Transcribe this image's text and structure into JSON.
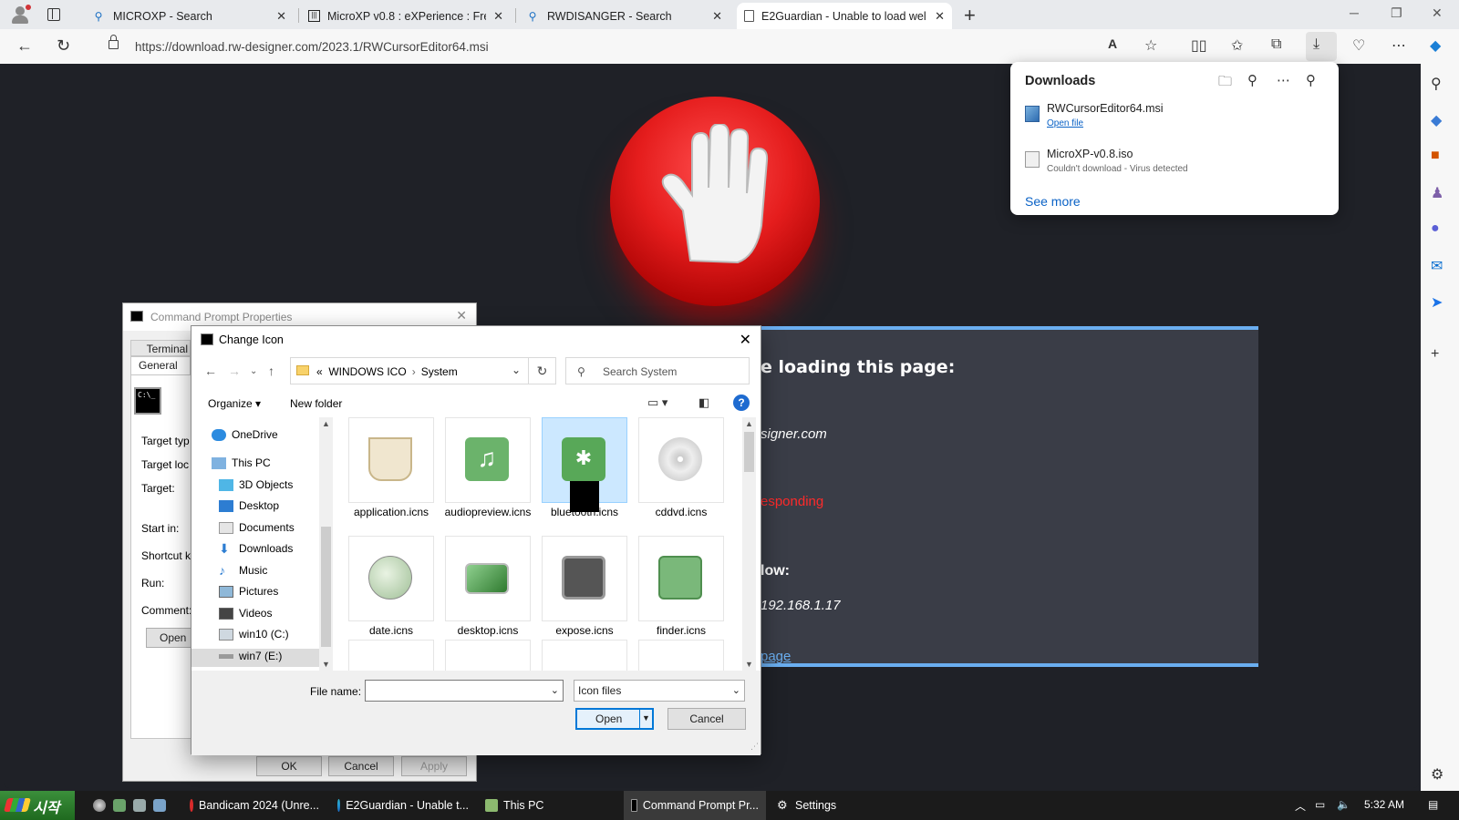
{
  "browser": {
    "tabs": [
      {
        "title": "MICROXP - Search",
        "icon": "search-icon"
      },
      {
        "title": "MicroXP v0.8 : eXPerience : Free",
        "icon": "archive-icon"
      },
      {
        "title": "RWDISANGER - Search",
        "icon": "search-icon"
      },
      {
        "title": "E2Guardian - Unable to load wel",
        "icon": "page-icon"
      }
    ],
    "url": "https://download.rw-designer.com/2023.1/RWCursorEditor64.msi"
  },
  "downloads": {
    "title": "Downloads",
    "items": [
      {
        "name": "RWCursorEditor64.msi",
        "status": "Open file"
      },
      {
        "name": "MicroXP-v0.8.iso",
        "status": "Couldn't download - Virus detected"
      }
    ],
    "see_more": "See more"
  },
  "blocked_page": {
    "line_heading": "e loading this page:",
    "line_domain": "signer.com",
    "line_error": "esponding",
    "line_below": "low:",
    "line_ip": "192.168.1.17",
    "line_link": "page"
  },
  "cmd_props": {
    "title": "Command Prompt Properties",
    "tab_terminal": "Terminal",
    "tab_general": "General",
    "labels": [
      "Target typ",
      "Target loc",
      "Target:",
      "Start in:",
      "Shortcut k",
      "Run:",
      "Comment:"
    ],
    "open_btn": "Open",
    "ok": "OK",
    "cancel": "Cancel",
    "apply": "Apply",
    "icon_text": "C:\\_"
  },
  "change_icon": {
    "title": "Change Icon",
    "path": [
      "WINDOWS ICO",
      "System"
    ],
    "path_prefix": "«",
    "search_placeholder": "Search System",
    "organize": "Organize",
    "new_folder": "New folder",
    "help": "?",
    "nav": [
      "OneDrive",
      "This PC",
      "3D Objects",
      "Desktop",
      "Documents",
      "Downloads",
      "Music",
      "Pictures",
      "Videos",
      "win10 (C:)",
      "win7 (E:)"
    ],
    "files": [
      {
        "name": "application.icns",
        "color": "#e8d8b0"
      },
      {
        "name": "audiopreview.icns",
        "color": "#6bb36b"
      },
      {
        "name": "bluetooth.icns",
        "color": "#58a858"
      },
      {
        "name": "cddvd.icns",
        "color": "#d0d0d0"
      },
      {
        "name": "date.icns",
        "color": "#a8c8a0"
      },
      {
        "name": "desktop.icns",
        "color": "#5a9e5a"
      },
      {
        "name": "expose.icns",
        "color": "#8a9a8a"
      },
      {
        "name": "finder.icns",
        "color": "#7ab87a"
      }
    ],
    "file_name_label": "File name:",
    "file_name_value": "",
    "file_type": "Icon files",
    "open": "Open",
    "cancel": "Cancel"
  },
  "taskbar": {
    "start": "시작",
    "tasks": [
      "Bandicam 2024 (Unre...",
      "E2Guardian - Unable t...",
      "This PC",
      "Command Prompt Pr...",
      "Settings"
    ],
    "time": "5:32 AM"
  },
  "colors": {
    "page_bg": "#1f2127",
    "accent": "#0078d7",
    "link": "#0a62c6",
    "error": "#ff2a2a"
  }
}
